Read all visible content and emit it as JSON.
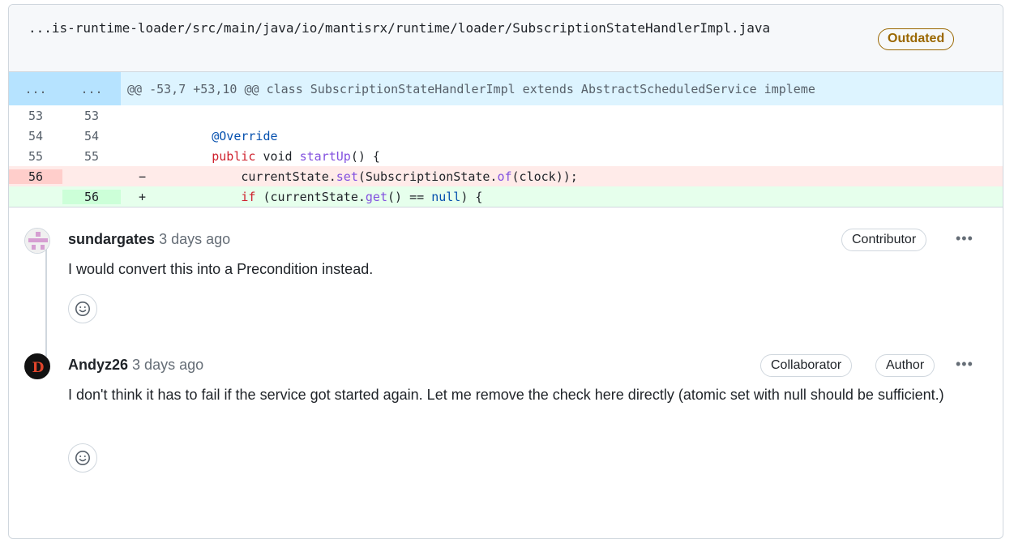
{
  "file": {
    "path": "...is-runtime-loader/src/main/java/io/mantisrx/runtime/loader/SubscriptionStateHandlerImpl.java",
    "badge": "Outdated"
  },
  "diff": {
    "hunk_old": "...",
    "hunk_new": "...",
    "hunk_header": "@@ -53,7 +53,10 @@ class SubscriptionStateHandlerImpl extends AbstractScheduledService impleme",
    "rows": [
      {
        "old": "53",
        "new": "53",
        "marker": "",
        "code": ""
      },
      {
        "old": "54",
        "new": "54",
        "marker": "",
        "code": "@Override"
      },
      {
        "old": "55",
        "new": "55",
        "marker": "",
        "code": "public void startUp() {"
      },
      {
        "old": "56",
        "new": "",
        "marker": "−",
        "code": "currentState.set(SubscriptionState.of(clock));"
      },
      {
        "old": "",
        "new": "56",
        "marker": "+",
        "code": "if (currentState.get() == null) {"
      }
    ]
  },
  "comments": [
    {
      "author": "sundargates",
      "time": "3 days ago",
      "badges": [
        "Contributor"
      ],
      "body": "I would convert this into a Precondition instead.",
      "avatar": "identicon-avatar"
    },
    {
      "author": "Andyz26",
      "time": "3 days ago",
      "badges": [
        "Collaborator",
        "Author"
      ],
      "body": "I don't think it has to fail if the service got started again. Let me remove the check here directly (atomic set with null should be sufficient.)",
      "avatar": "d-logo-avatar"
    }
  ],
  "colors": {
    "outdated": "#9a6700",
    "hunk_bg": "#ddf4ff",
    "del_bg": "#ffebe9",
    "add_bg": "#e6ffec"
  }
}
